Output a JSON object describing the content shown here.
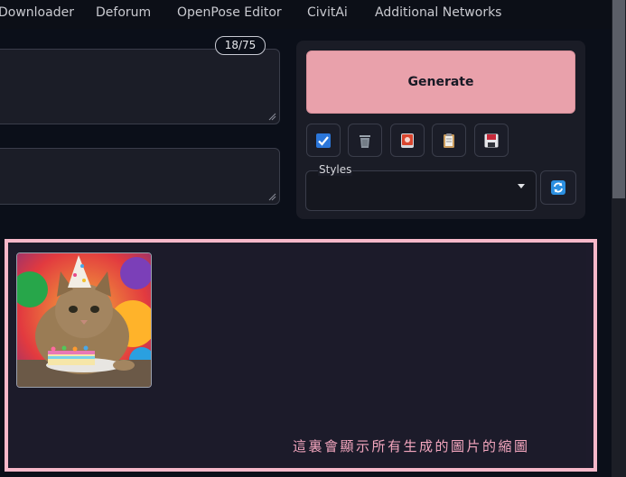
{
  "tabs": [
    "Downloader",
    "Deforum",
    "OpenPose Editor",
    "CivitAi",
    "Additional Networks"
  ],
  "prompt": {
    "token_counter": "18/75",
    "positive_value": "",
    "negative_value": ""
  },
  "generate": {
    "label": "Generate"
  },
  "tools": [
    {
      "icon": "checkbox-icon"
    },
    {
      "icon": "trash-icon"
    },
    {
      "icon": "style-apply-icon"
    },
    {
      "icon": "clipboard-icon"
    },
    {
      "icon": "save-icon"
    }
  ],
  "styles": {
    "label": "Styles",
    "selected": ""
  },
  "gallery": {
    "caption": "這裏會顯示所有生成的圖片的縮圖"
  },
  "colors": {
    "accent": "#e9a1ab",
    "gallery_border": "#f7b8c9",
    "background": "#0b0f19"
  }
}
